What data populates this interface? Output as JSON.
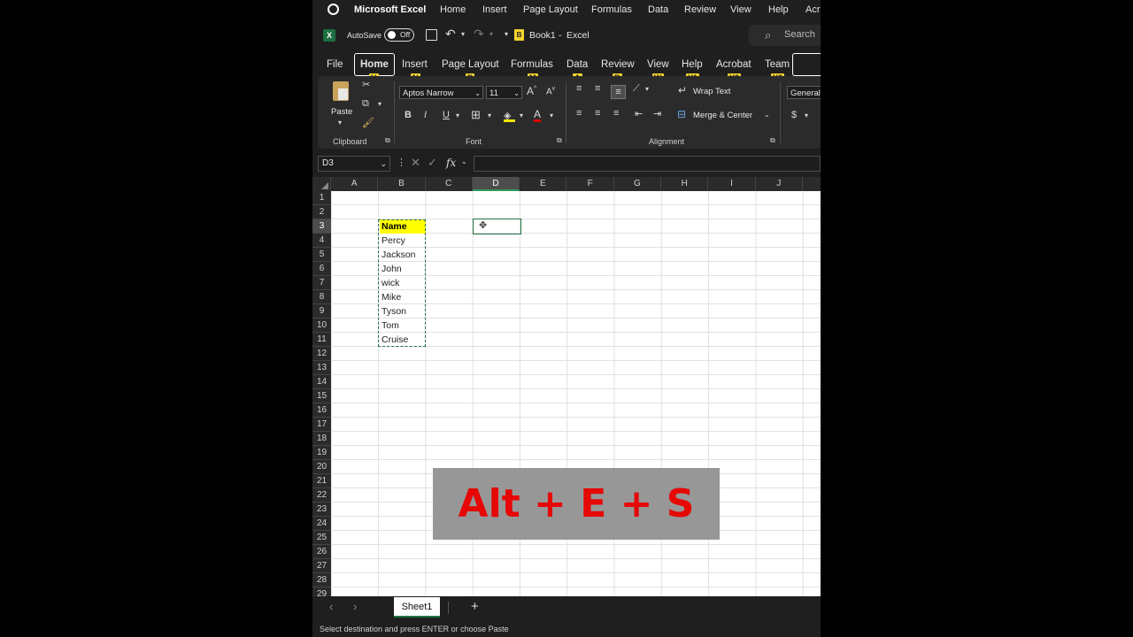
{
  "titlebar": {
    "app_name": "Microsoft Excel",
    "menu": [
      "Home",
      "Insert",
      "Page Layout",
      "Formulas",
      "Data",
      "Review",
      "View",
      "Help",
      "Acr"
    ]
  },
  "qat": {
    "autosave_label": "AutoSave",
    "autosave_state": "Off",
    "doc_badge": "B",
    "doc_title": "Book1",
    "doc_sep": "-",
    "app": "Excel",
    "search_placeholder": "Search"
  },
  "tabs": [
    "File",
    "Home",
    "Insert",
    "Page Layout",
    "Formulas",
    "Data",
    "Review",
    "View",
    "Help",
    "Acrobat",
    "Team"
  ],
  "keytips": [
    "H",
    "N",
    "P",
    "M",
    "A",
    "R",
    "W",
    "Y1",
    "Y2",
    "Y3"
  ],
  "ribbon": {
    "clipboard": {
      "paste": "Paste",
      "label": "Clipboard"
    },
    "font": {
      "name": "Aptos Narrow",
      "size": "11",
      "label": "Font",
      "bold": "B",
      "italic": "I",
      "underline": "U"
    },
    "alignment": {
      "wrap_text": "Wrap Text",
      "merge_center": "Merge & Center",
      "label": "Alignment"
    },
    "number": {
      "format": "General",
      "currency": "$"
    }
  },
  "formula_bar": {
    "name_box": "D3",
    "fx": "fx"
  },
  "columns": [
    "A",
    "B",
    "C",
    "D",
    "E",
    "F",
    "G",
    "H",
    "I",
    "J"
  ],
  "rows": [
    "1",
    "2",
    "3",
    "4",
    "5",
    "6",
    "7",
    "8",
    "9",
    "10",
    "11",
    "12",
    "13",
    "14",
    "15",
    "16",
    "17",
    "18",
    "19",
    "20",
    "21",
    "22",
    "23",
    "24",
    "25",
    "26",
    "27",
    "28",
    "29"
  ],
  "cells": {
    "header": "Name",
    "names": [
      "Percy",
      "Jackson",
      "John",
      "wick",
      "Mike",
      "Tyson",
      "Tom",
      "Cruise"
    ]
  },
  "overlay_text": "Alt + E + S",
  "sheet_tab": "Sheet1",
  "add_sheet": "+",
  "status": "Select destination and press ENTER or choose Paste"
}
